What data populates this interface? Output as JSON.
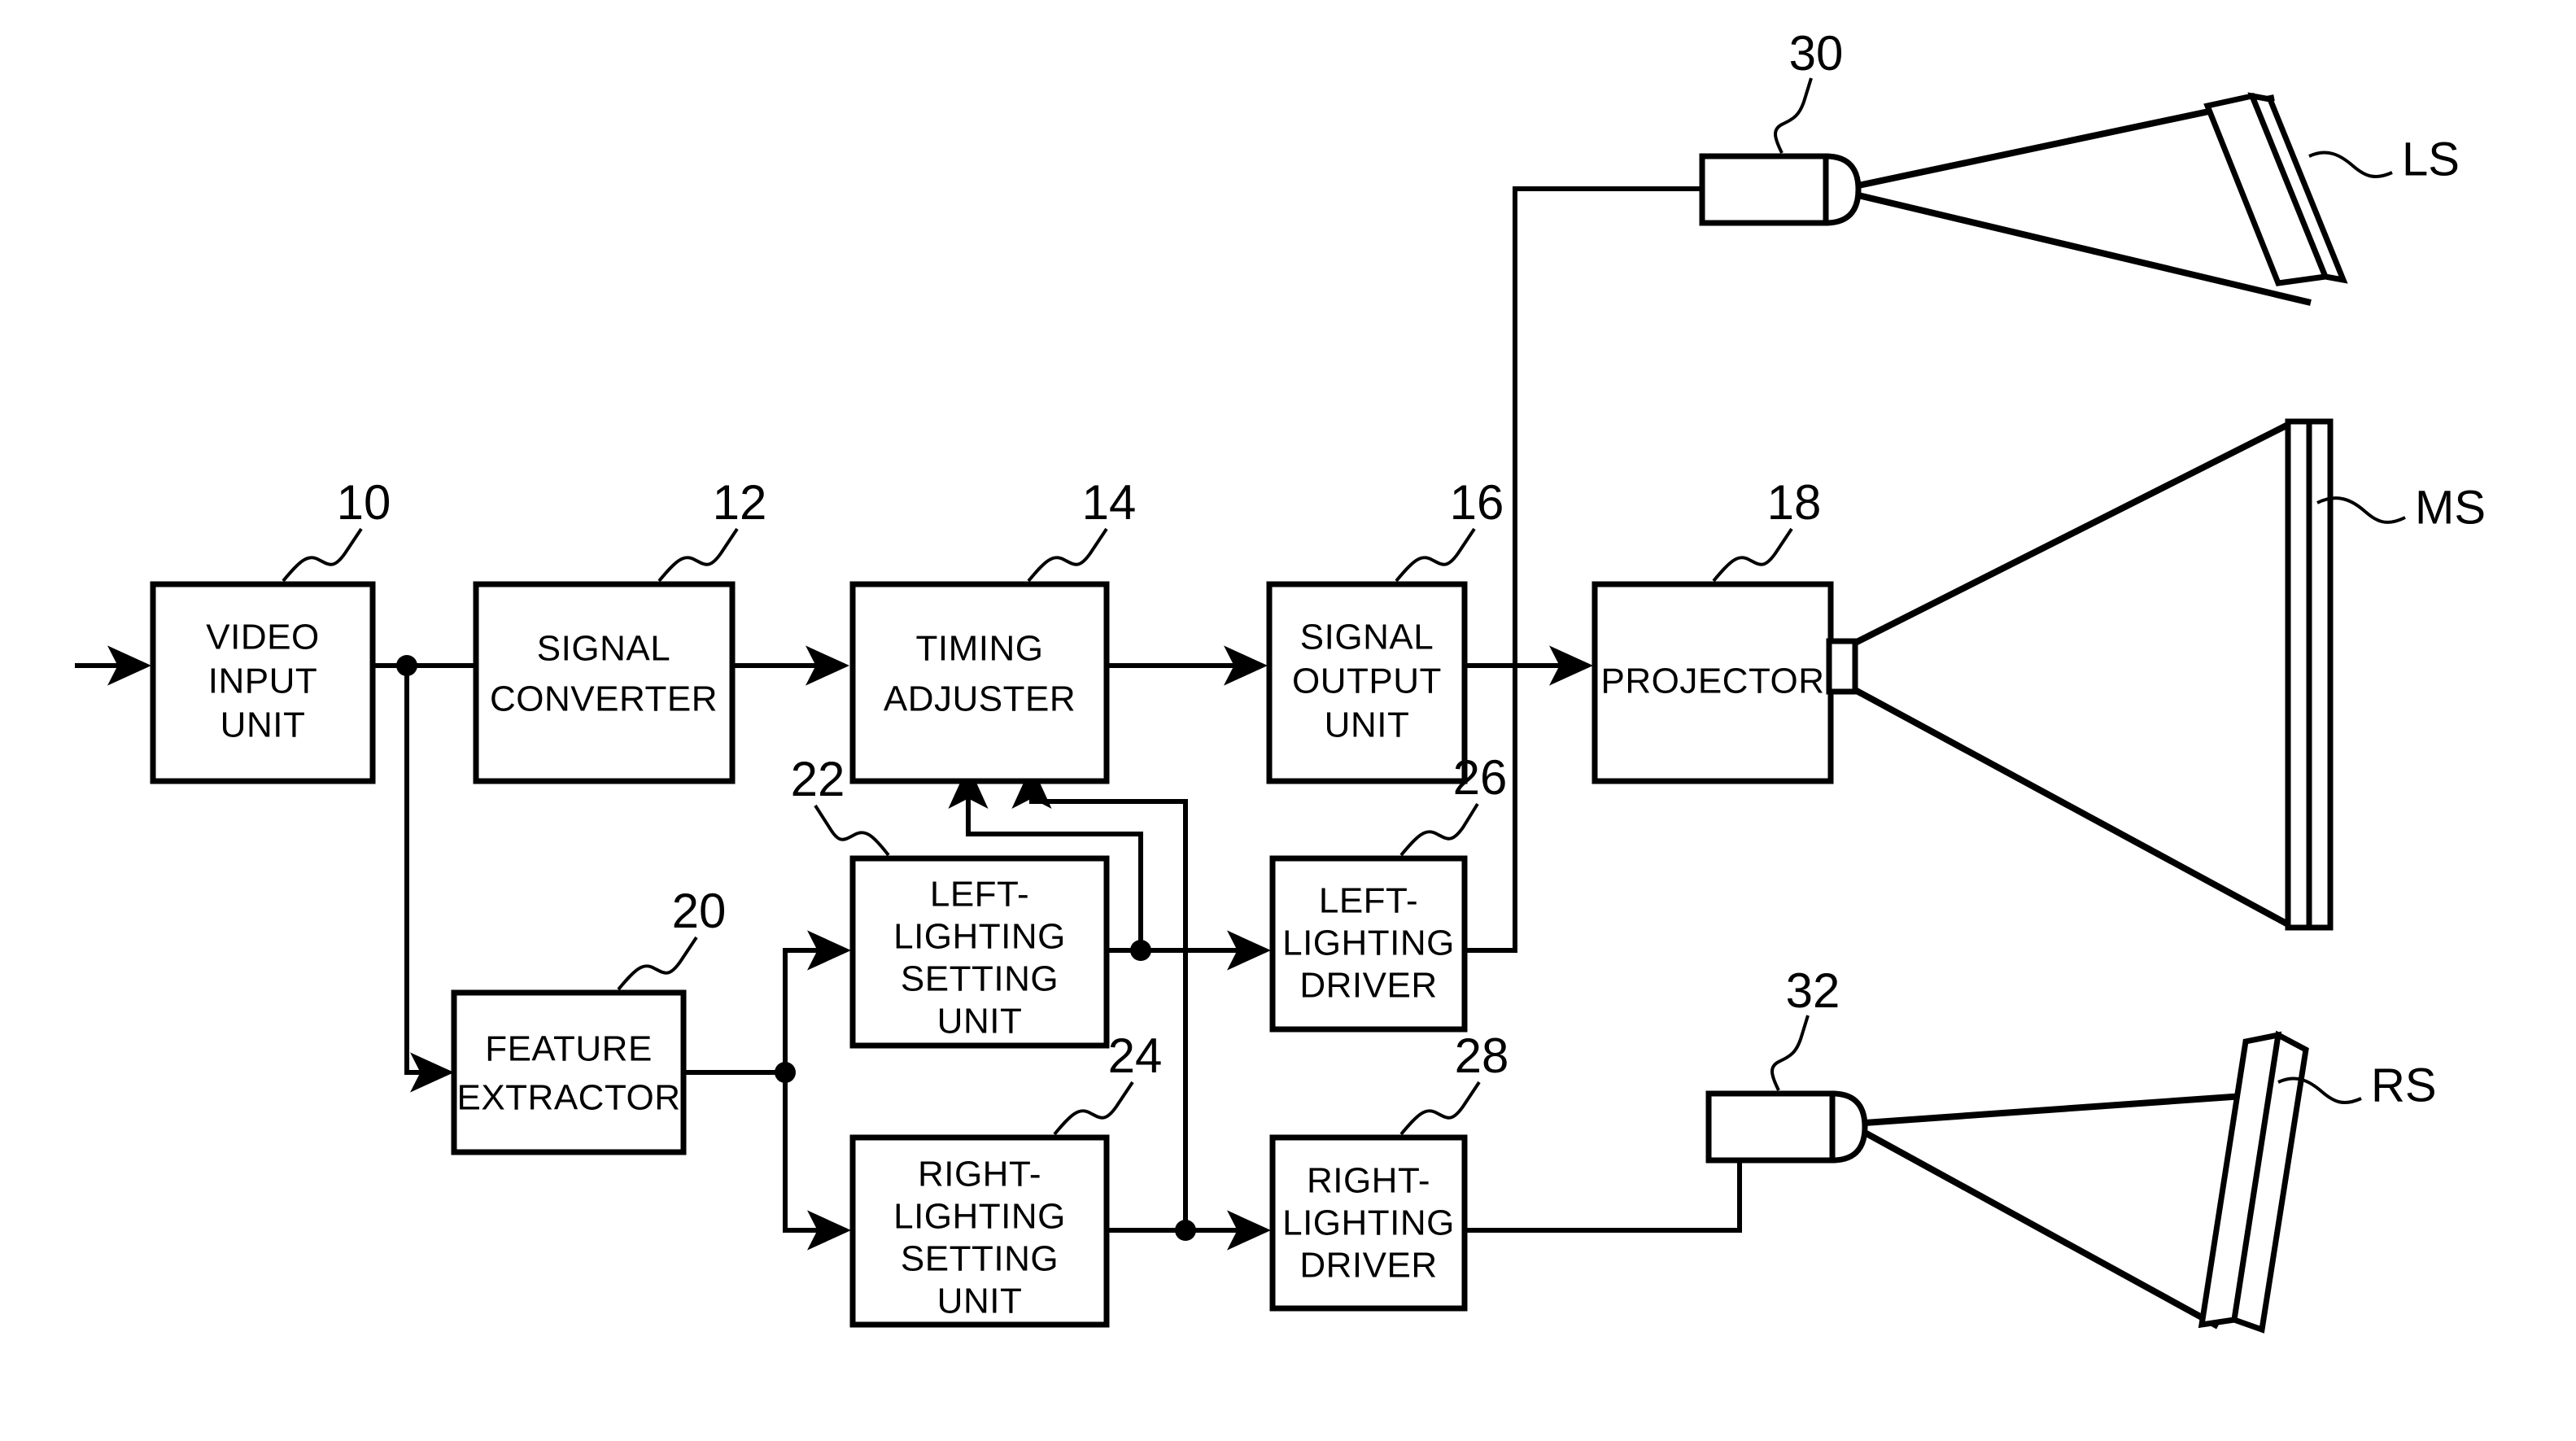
{
  "figure": {
    "type": "patent-block-diagram",
    "background": "#ffffff",
    "line_color": "#000000"
  },
  "blocks": [
    {
      "id": "video_input_unit",
      "ref": "10",
      "lines": [
        "VIDEO",
        "INPUT",
        "UNIT"
      ]
    },
    {
      "id": "signal_converter",
      "ref": "12",
      "lines": [
        "SIGNAL",
        "CONVERTER"
      ]
    },
    {
      "id": "timing_adjuster",
      "ref": "14",
      "lines": [
        "TIMING",
        "ADJUSTER"
      ]
    },
    {
      "id": "signal_output_unit",
      "ref": "16",
      "lines": [
        "SIGNAL",
        "OUTPUT",
        "UNIT"
      ]
    },
    {
      "id": "projector",
      "ref": "18",
      "lines": [
        "PROJECTOR"
      ]
    },
    {
      "id": "feature_extractor",
      "ref": "20",
      "lines": [
        "FEATURE",
        "EXTRACTOR"
      ]
    },
    {
      "id": "left_lighting_setting_unit",
      "ref": "22",
      "lines": [
        "LEFT-",
        "LIGHTING",
        "SETTING",
        "UNIT"
      ]
    },
    {
      "id": "right_lighting_setting_unit",
      "ref": "24",
      "lines": [
        "RIGHT-",
        "LIGHTING",
        "SETTING",
        "UNIT"
      ]
    },
    {
      "id": "left_lighting_driver",
      "ref": "26",
      "lines": [
        "LEFT-",
        "LIGHTING",
        "DRIVER"
      ]
    },
    {
      "id": "right_lighting_driver",
      "ref": "28",
      "lines": [
        "RIGHT-",
        "LIGHTING",
        "DRIVER"
      ]
    }
  ],
  "lamps": [
    {
      "id": "left_lamp",
      "ref": "30",
      "screen": "LS"
    },
    {
      "id": "right_lamp",
      "ref": "32",
      "screen": "RS"
    }
  ],
  "screens": [
    {
      "id": "left_screen",
      "label": "LS"
    },
    {
      "id": "main_screen",
      "label": "MS"
    },
    {
      "id": "right_screen",
      "label": "RS"
    }
  ],
  "ref_numbers": [
    "10",
    "12",
    "14",
    "16",
    "18",
    "20",
    "22",
    "24",
    "26",
    "28",
    "30",
    "32"
  ],
  "screen_labels": [
    "LS",
    "MS",
    "RS"
  ],
  "text": {
    "b10_l1": "VIDEO",
    "b10_l2": "INPUT",
    "b10_l3": "UNIT",
    "b12_l1": "SIGNAL",
    "b12_l2": "CONVERTER",
    "b14_l1": "TIMING",
    "b14_l2": "ADJUSTER",
    "b16_l1": "SIGNAL",
    "b16_l2": "OUTPUT",
    "b16_l3": "UNIT",
    "b18_l1": "PROJECTOR",
    "b20_l1": "FEATURE",
    "b20_l2": "EXTRACTOR",
    "b22_l1": "LEFT-",
    "b22_l2": "LIGHTING",
    "b22_l3": "SETTING",
    "b22_l4": "UNIT",
    "b24_l1": "RIGHT-",
    "b24_l2": "LIGHTING",
    "b24_l3": "SETTING",
    "b24_l4": "UNIT",
    "b26_l1": "LEFT-",
    "b26_l2": "LIGHTING",
    "b26_l3": "DRIVER",
    "b28_l1": "RIGHT-",
    "b28_l2": "LIGHTING",
    "b28_l3": "DRIVER",
    "n10": "10",
    "n12": "12",
    "n14": "14",
    "n16": "16",
    "n18": "18",
    "n20": "20",
    "n22": "22",
    "n24": "24",
    "n26": "26",
    "n28": "28",
    "n30": "30",
    "n32": "32",
    "ls": "LS",
    "ms": "MS",
    "rs": "RS"
  }
}
